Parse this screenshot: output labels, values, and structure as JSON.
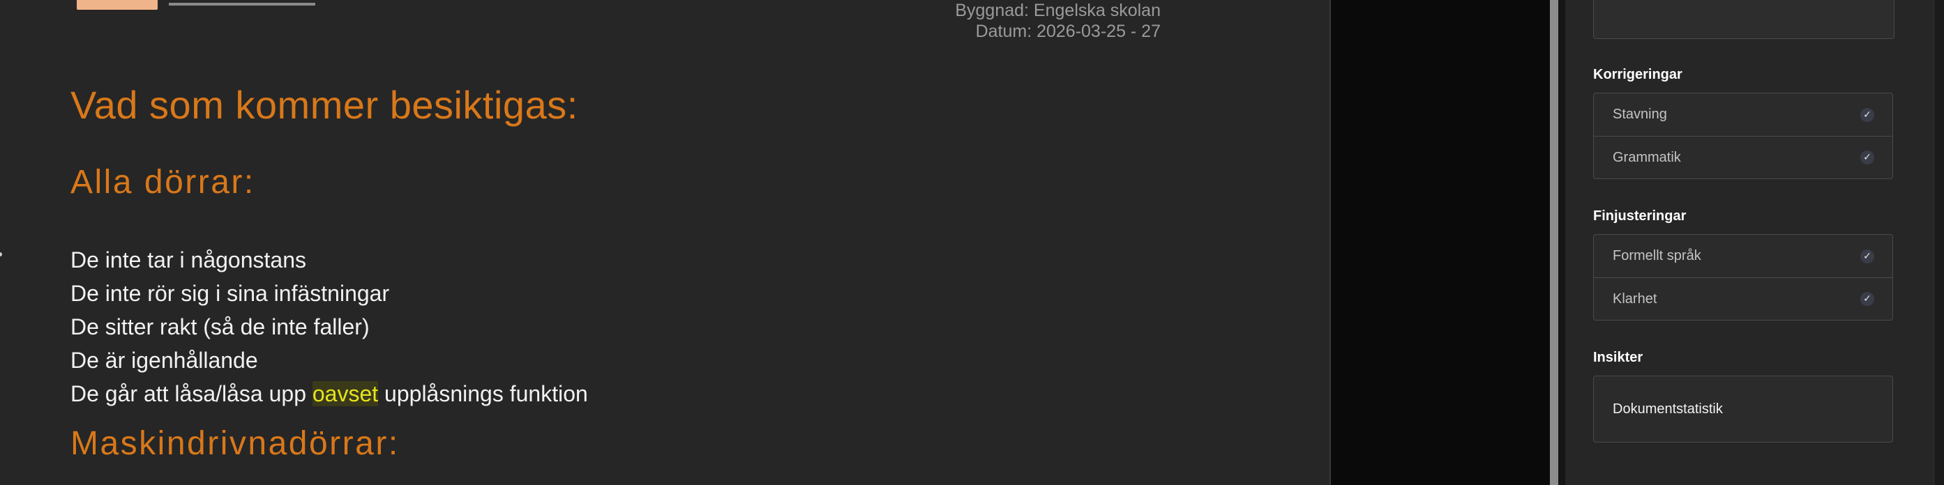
{
  "document": {
    "meta": {
      "building": "Byggnad: Engelska skolan",
      "date": "Datum: 2026-03-25 - 27"
    },
    "heading": "Vad som kommer besiktigas:",
    "sections": [
      {
        "title": "Alla dörrar:",
        "items": [
          "De inte tar i någonstans",
          "De inte rör sig i sina infästningar",
          "De sitter rakt (så de inte faller)",
          "De är igenhållande"
        ],
        "last_item": {
          "before": "De går att låsa/låsa upp ",
          "flagged": "oavset",
          "after": " upplåsnings funktion"
        }
      },
      {
        "title": "Maskindrivnadörrar:"
      }
    ],
    "colors": {
      "heading": "#d9781a",
      "flagged_word": "#e6e31e",
      "body_text": "#f2f2f2",
      "background": "#262626"
    }
  },
  "panel": {
    "corrections": {
      "title": "Korrigeringar",
      "options": [
        {
          "label": "Stavning",
          "checked": true,
          "icon": "check-icon"
        },
        {
          "label": "Grammatik",
          "checked": true,
          "icon": "check-icon"
        }
      ]
    },
    "finetuning": {
      "title": "Finjusteringar",
      "options": [
        {
          "label": "Formellt språk",
          "checked": true,
          "icon": "check-icon"
        },
        {
          "label": "Klarhet",
          "checked": true,
          "icon": "check-icon"
        }
      ]
    },
    "insights": {
      "title": "Insikter",
      "item": "Dokumentstatistik"
    },
    "check_glyph": "✓"
  }
}
